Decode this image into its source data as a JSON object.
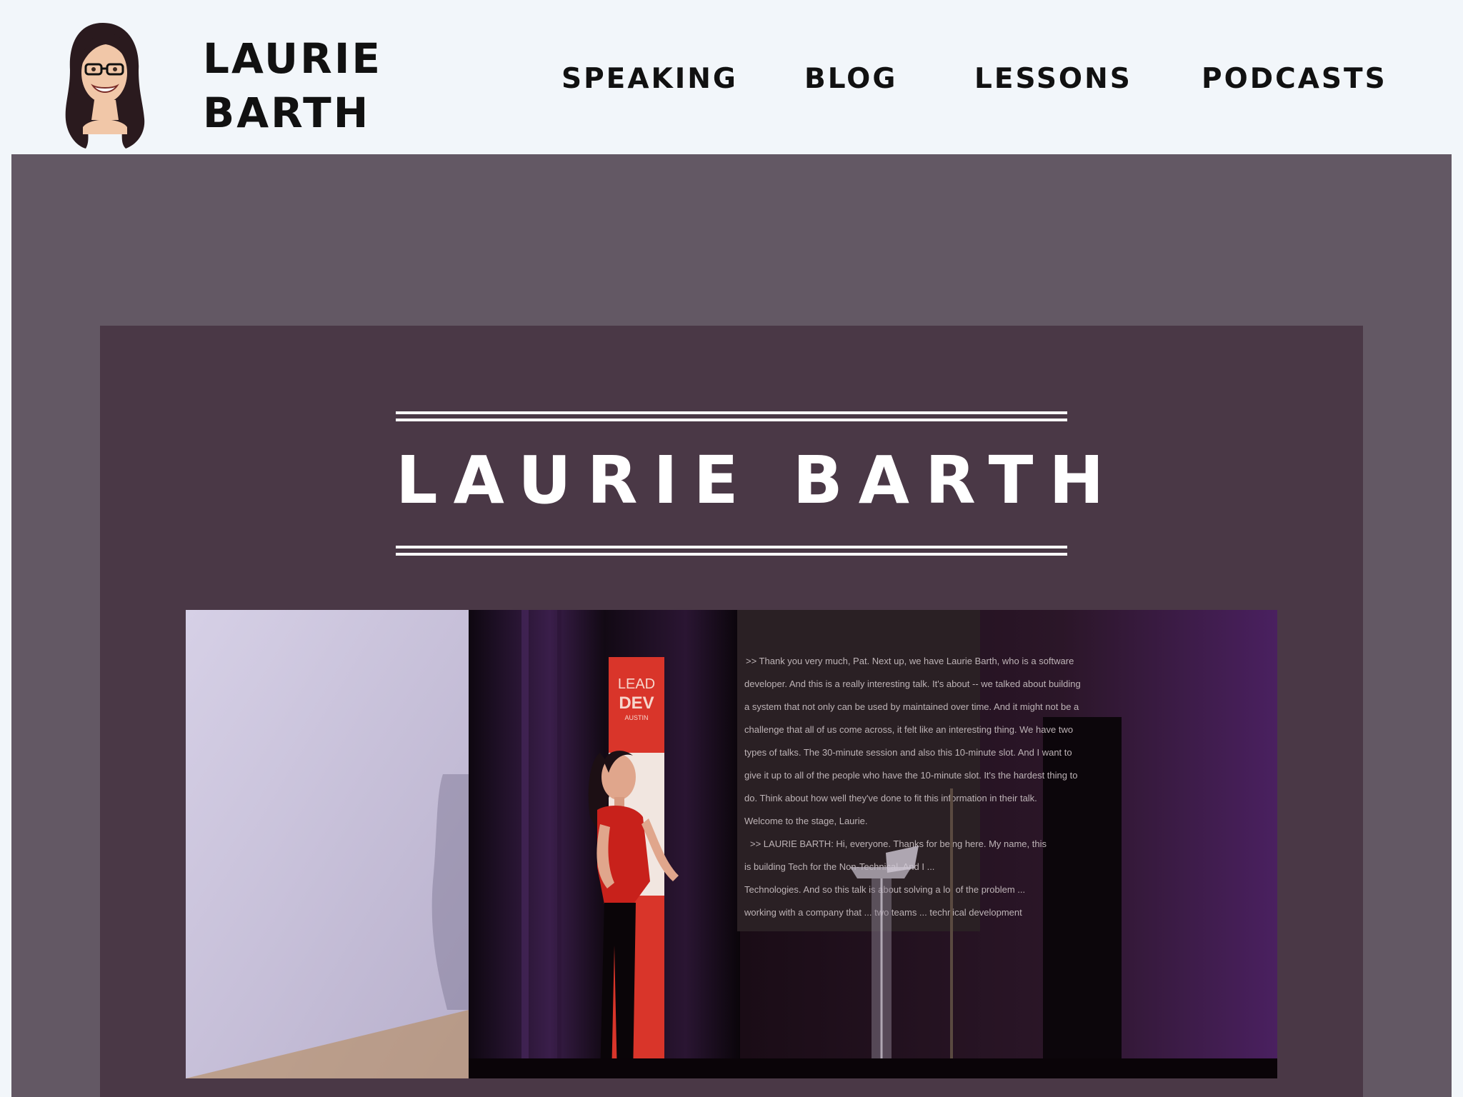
{
  "header": {
    "site_name": "LAURIE BARTH",
    "nav": [
      {
        "label": "SPEAKING"
      },
      {
        "label": "BLOG"
      },
      {
        "label": "LESSONS"
      },
      {
        "label": "PODCASTS"
      }
    ]
  },
  "hero": {
    "title": "LAURIE BARTH",
    "banner_text_top": "LEAD",
    "banner_text_bottom": "DEV",
    "banner_text_city": "AUSTIN",
    "caption_lines": [
      ">> Thank you very much, Pat. Next up, we have Laurie Barth, who is a software",
      "developer. And this is a really interesting talk. It's about -- we talked about building",
      "a system that not only can be used by maintained over time. And it might not be a",
      "challenge that all of us come across, it felt like an interesting thing. We have two",
      "types of talks. The 30-minute session and also this 10-minute slot. And I want to",
      "give it up to all of the people who have the 10-minute slot. It's the hardest thing to",
      "do. Think about how well they've done to fit this information in their talk.",
      "Welcome to the stage, Laurie.",
      ">> LAURIE BARTH: Hi, everyone. Thanks for being here. My name, this",
      "is building Tech for the Non-Technical. And I ...",
      "Technologies. And so this talk is about solving a lot of the problem ...",
      "working with a company that ... two teams ... technical development"
    ]
  },
  "colors": {
    "header_bg": "#f2f6fa",
    "outer_bg": "#635864",
    "inner_bg": "#4a3846",
    "text_dark": "#111111",
    "text_light": "#ffffff",
    "banner_red": "#d9352a"
  }
}
